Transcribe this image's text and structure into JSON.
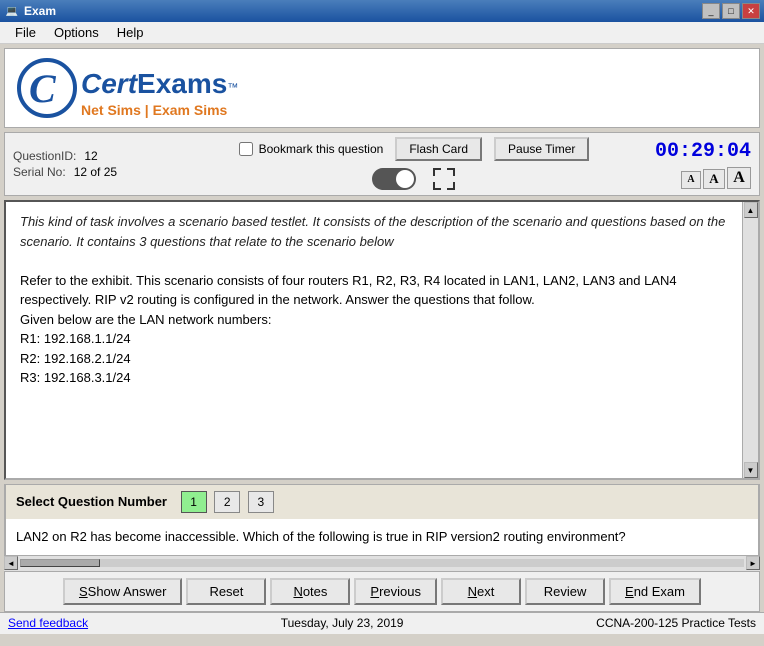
{
  "window": {
    "title": "Exam",
    "icon": "💻"
  },
  "menu": {
    "items": [
      "File",
      "Options",
      "Help"
    ]
  },
  "logo": {
    "c_letter": "C",
    "cert": "Cert",
    "exams": "Exams",
    "tm": "™",
    "subtitle": "Net Sims | Exam Sims"
  },
  "info_bar": {
    "question_id_label": "QuestionID:",
    "question_id_value": "12",
    "serial_label": "Serial No:",
    "serial_value": "12 of 25",
    "bookmark_label": "Bookmark this question",
    "flash_card_btn": "Flash Card",
    "pause_timer_btn": "Pause Timer",
    "timer": "00:29:04",
    "font_a_small": "A",
    "font_a_medium": "A",
    "font_a_large": "A"
  },
  "question_content": {
    "intro": "This kind of task involves a scenario based testlet. It consists of the description of the scenario and questions based on the scenario. It contains 3 questions that relate to the scenario below",
    "body": "Refer to the exhibit. This scenario consists of four routers R1, R2, R3, R4 located in LAN1, LAN2, LAN3 and LAN4 respectively. RIP v2 routing is configured in the network. Answer the questions that follow.\nGiven below are the LAN network numbers:\nR1: 192.168.1.1/24\nR2: 192.168.2.1/24\nR3: 192.168.3.1/24"
  },
  "select_question": {
    "label": "Select Question Number",
    "numbers": [
      "1",
      "2",
      "3"
    ],
    "active": 0
  },
  "sub_question": "LAN2 on R2 has become inaccessible. Which of the following is true in RIP version2 routing environment?",
  "bottom_buttons": {
    "show_answer": "Show Answer",
    "reset": "Reset",
    "notes": "Notes",
    "previous": "Previous",
    "next": "Next",
    "review": "Review",
    "end_exam": "End Exam"
  },
  "status_bar": {
    "feedback": "Send feedback",
    "date": "Tuesday, July 23, 2019",
    "product": "CCNA-200-125 Practice Tests"
  }
}
